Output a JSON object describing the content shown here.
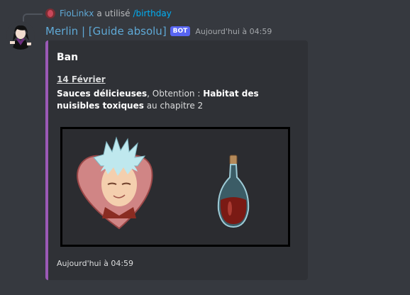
{
  "reply": {
    "username": "FioLinkx",
    "action": "a utilisé",
    "command": "/birthday"
  },
  "message": {
    "author": "Merlin | [Guide absolu]",
    "badge": "BOT",
    "timestamp": "Aujourd'hui à 04:59"
  },
  "embed": {
    "accent_color": "#9b59b6",
    "title": "Ban",
    "date": "14 Février",
    "item_name": "Sauces délicieuses",
    "obtain_label": ", Obtention : ",
    "obtain_location": "Habitat des nuisibles toxiques",
    "chapter_text": " au chapitre 2",
    "footer": "Aujourd'hui à 04:59"
  }
}
